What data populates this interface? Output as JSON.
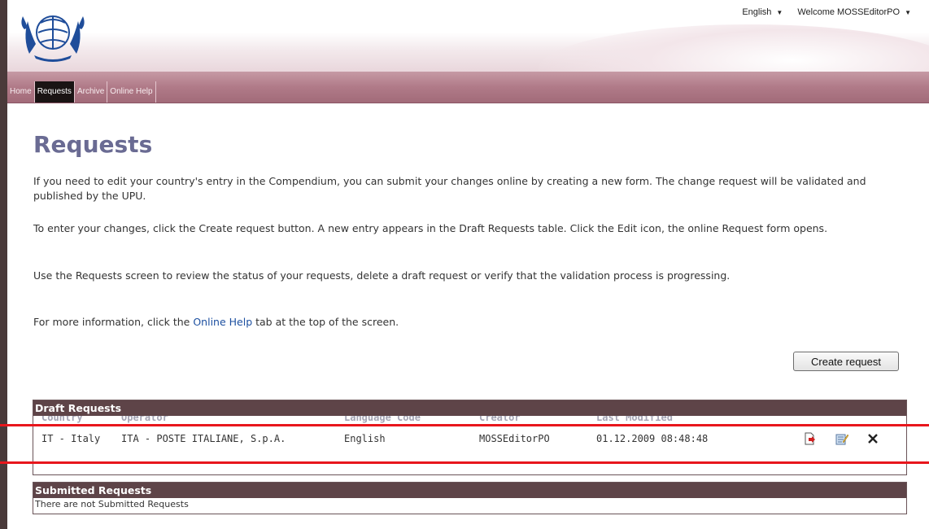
{
  "header": {
    "language": "English",
    "welcome": "Welcome MOSSEditorPO",
    "logo_icon": "upu-emblem-icon"
  },
  "nav": {
    "items": [
      {
        "label": "Home",
        "active": false
      },
      {
        "label": "Requests",
        "active": true
      },
      {
        "label": "Archive",
        "active": false
      },
      {
        "label": "Online Help",
        "active": false
      }
    ]
  },
  "main": {
    "title": "Requests",
    "p1": "If you need to edit your country's entry in the Compendium, you can submit your changes online by creating a new form. The change request will be validated and published by the UPU.",
    "p2": "To enter your changes, click the Create request button. A new entry appears in the Draft Requests table. Click the Edit icon, the online Request form opens.",
    "p3": "Use the Requests screen to review the status of your requests, delete a draft request or verify that the validation process is progressing.",
    "p4_before": "For more information, click the ",
    "p4_link": "Online Help",
    "p4_after": " tab at the top of the screen.",
    "create_button": "Create request"
  },
  "draft": {
    "title": "Draft Requests",
    "columns": [
      "Country",
      "Operator",
      "Language Code",
      "Creator",
      "Last Modified"
    ],
    "rows": [
      {
        "country": "IT - Italy",
        "operator": "ITA - POSTE ITALIANE, S.p.A.",
        "language": "English",
        "creator": "MOSSEditorPO",
        "modified": "01.12.2009 08:48:48",
        "actions": [
          "submit-icon",
          "edit-icon",
          "delete-icon"
        ]
      }
    ]
  },
  "submitted": {
    "title": "Submitted Requests",
    "empty": "There are not Submitted Requests"
  },
  "colors": {
    "accent": "#5e4448",
    "title": "#6a6b93",
    "nav": "#b07a88",
    "highlight": "#e8161c"
  }
}
